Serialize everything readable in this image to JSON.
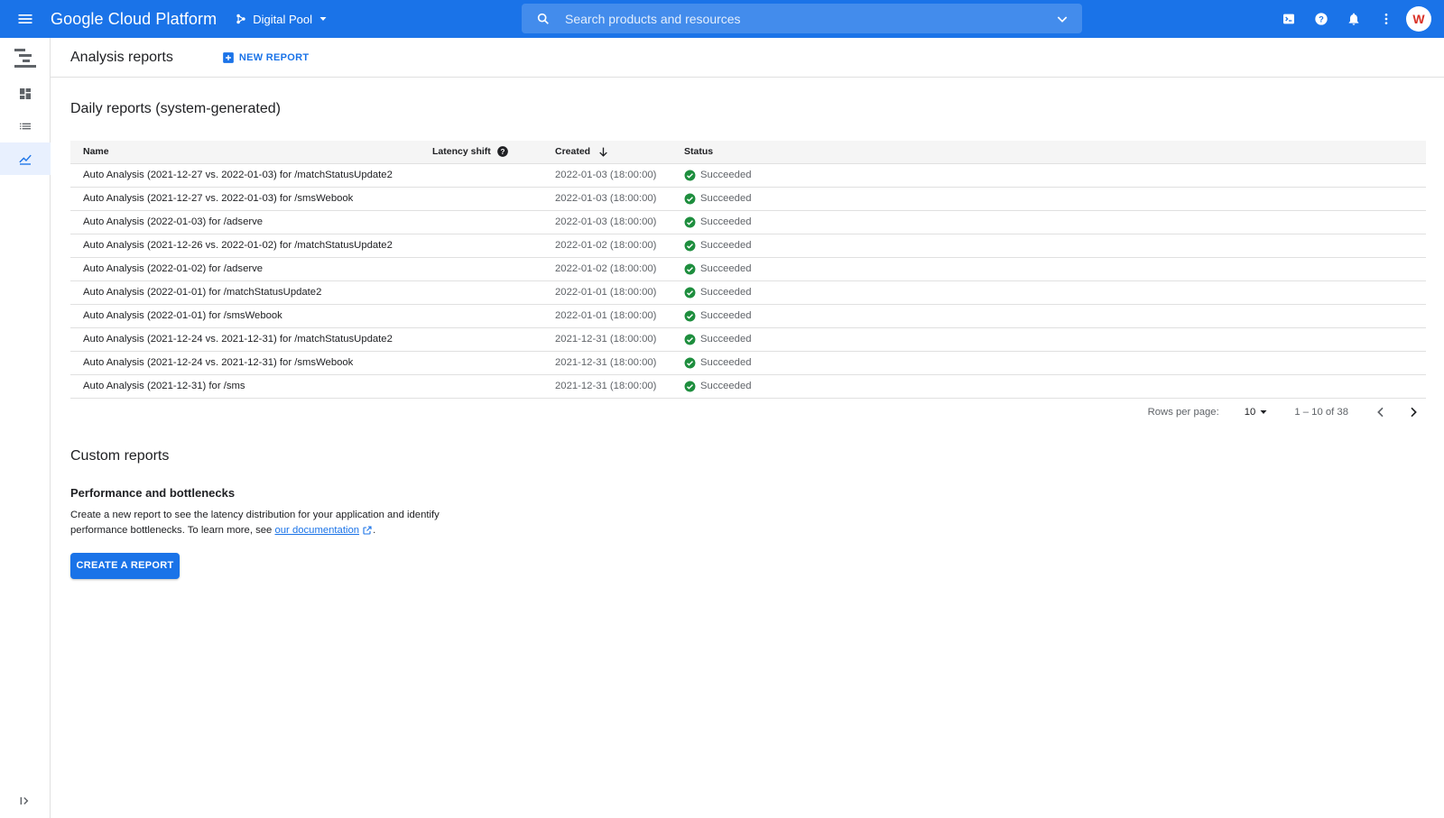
{
  "topbar": {
    "brand": "Google Cloud Platform",
    "project": "Digital Pool",
    "search_placeholder": "Search products and resources",
    "avatar_letter": "W"
  },
  "page": {
    "title": "Analysis reports",
    "new_report_label": "NEW REPORT"
  },
  "daily": {
    "title": "Daily reports (system-generated)",
    "columns": {
      "name": "Name",
      "latency": "Latency shift",
      "created": "Created",
      "status": "Status"
    },
    "rows": [
      {
        "name": "Auto Analysis (2021-12-27 vs. 2022-01-03) for /matchStatusUpdate2",
        "latency": "",
        "created": "2022-01-03 (18:00:00)",
        "status": "Succeeded"
      },
      {
        "name": "Auto Analysis (2021-12-27 vs. 2022-01-03) for /smsWebook",
        "latency": "",
        "created": "2022-01-03 (18:00:00)",
        "status": "Succeeded"
      },
      {
        "name": "Auto Analysis (2022-01-03) for /adserve",
        "latency": "",
        "created": "2022-01-03 (18:00:00)",
        "status": "Succeeded"
      },
      {
        "name": "Auto Analysis (2021-12-26 vs. 2022-01-02) for /matchStatusUpdate2",
        "latency": "",
        "created": "2022-01-02 (18:00:00)",
        "status": "Succeeded"
      },
      {
        "name": "Auto Analysis (2022-01-02) for /adserve",
        "latency": "",
        "created": "2022-01-02 (18:00:00)",
        "status": "Succeeded"
      },
      {
        "name": "Auto Analysis (2022-01-01) for /matchStatusUpdate2",
        "latency": "",
        "created": "2022-01-01 (18:00:00)",
        "status": "Succeeded"
      },
      {
        "name": "Auto Analysis (2022-01-01) for /smsWebook",
        "latency": "",
        "created": "2022-01-01 (18:00:00)",
        "status": "Succeeded"
      },
      {
        "name": "Auto Analysis (2021-12-24 vs. 2021-12-31) for /matchStatusUpdate2",
        "latency": "",
        "created": "2021-12-31 (18:00:00)",
        "status": "Succeeded"
      },
      {
        "name": "Auto Analysis (2021-12-24 vs. 2021-12-31) for /smsWebook",
        "latency": "",
        "created": "2021-12-31 (18:00:00)",
        "status": "Succeeded"
      },
      {
        "name": "Auto Analysis (2021-12-31) for /sms",
        "latency": "",
        "created": "2021-12-31 (18:00:00)",
        "status": "Succeeded"
      }
    ],
    "pager": {
      "rows_per_page_label": "Rows per page:",
      "rows_per_page_value": "10",
      "range": "1 – 10 of 38"
    }
  },
  "custom": {
    "title": "Custom reports",
    "perf_title": "Performance and bottlenecks",
    "desc_prefix": "Create a new report to see the latency distribution for your application and identify performance bottlenecks. To learn more, see ",
    "doc_link": "our documentation",
    "desc_suffix": ".",
    "create_label": "CREATE A REPORT"
  },
  "colors": {
    "brand_blue": "#1a73e8",
    "success_green": "#1e8e3e"
  },
  "icons": {
    "menu": "hamburger-menu-icon",
    "project": "project-hierarchy-icon",
    "search": "search-icon",
    "cloud_shell": "cloud-shell-icon",
    "help": "help-icon",
    "notifications": "bell-icon",
    "more": "more-vert-icon",
    "status_ok": "check-circle-icon"
  }
}
